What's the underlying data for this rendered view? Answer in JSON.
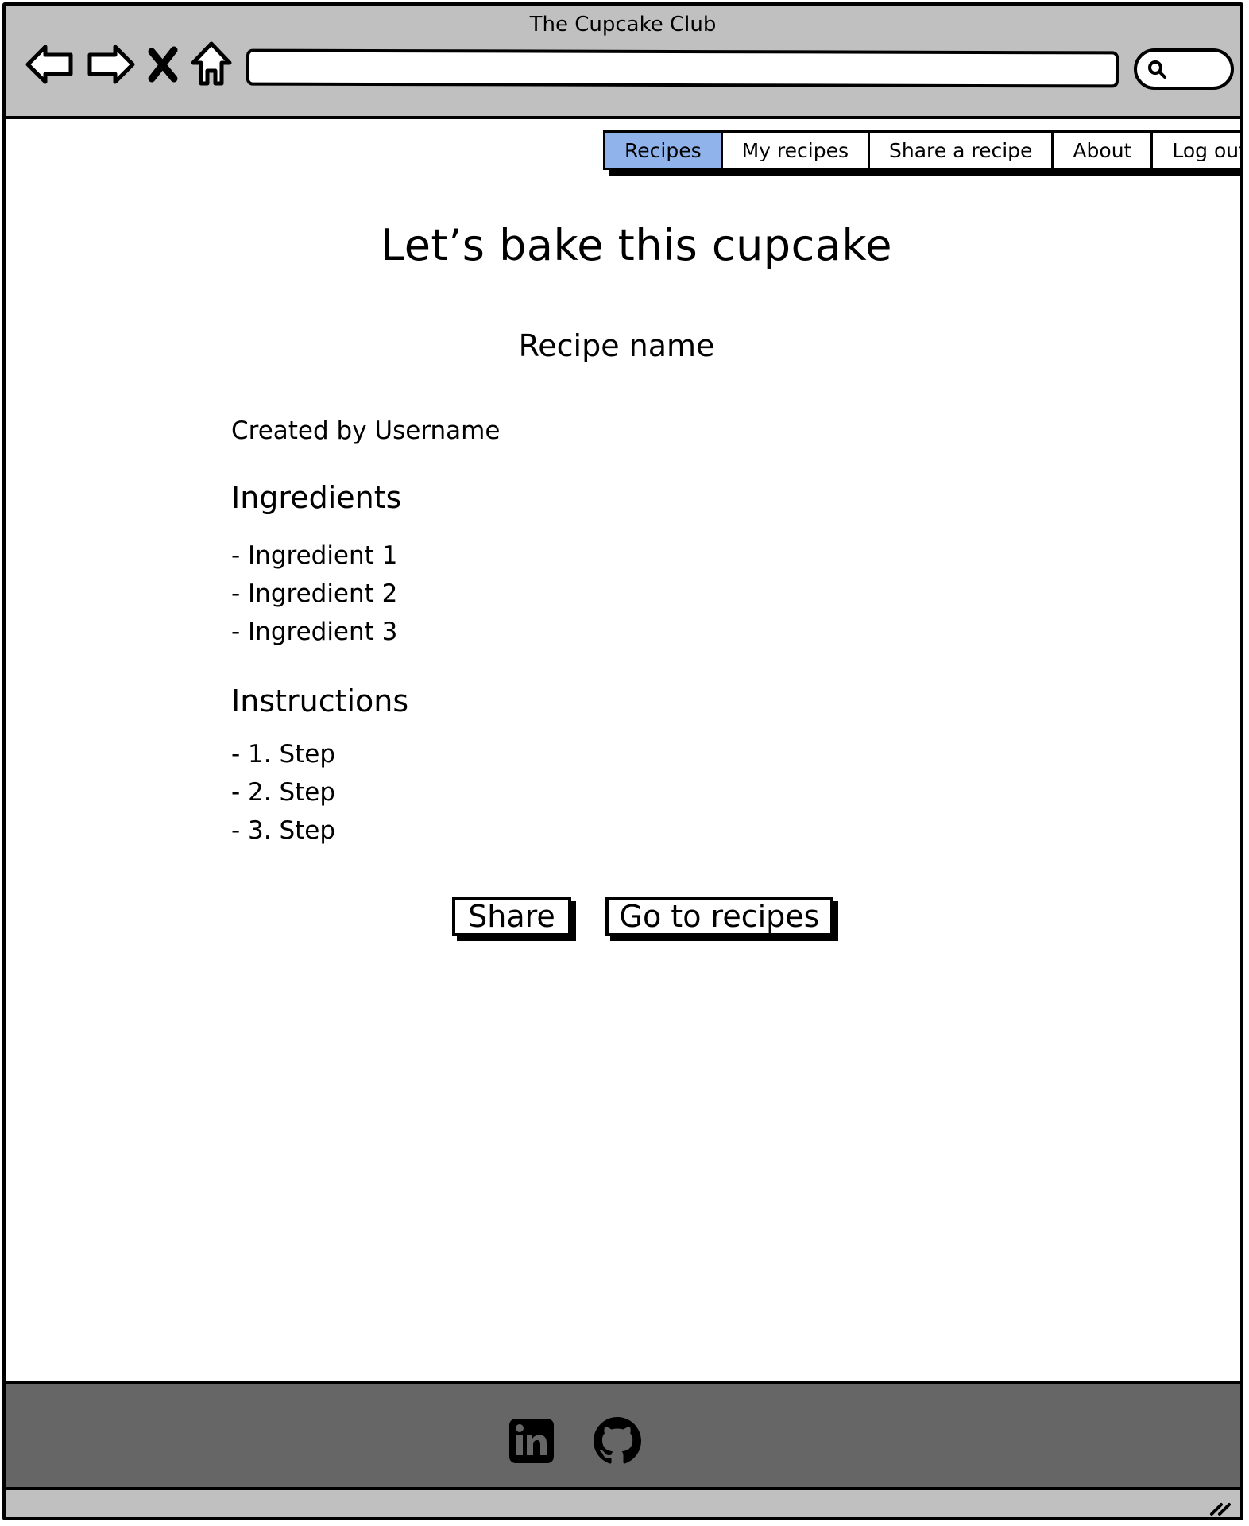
{
  "browser": {
    "window_title": "The Cupcake Club",
    "url": "",
    "search_placeholder": ""
  },
  "nav": {
    "tabs": [
      {
        "label": "Recipes",
        "active": true
      },
      {
        "label": "My recipes",
        "active": false
      },
      {
        "label": "Share a recipe",
        "active": false
      },
      {
        "label": "About",
        "active": false
      },
      {
        "label": "Log out",
        "active": false
      }
    ],
    "active_color": "#8fb3ea"
  },
  "main": {
    "title": "Let’s bake this cupcake",
    "recipe_name": "Recipe name",
    "creator": "Created by Username",
    "ingredients_heading": "Ingredients",
    "ingredients": [
      "- Ingredient 1",
      "- Ingredient 2",
      "- Ingredient 3"
    ],
    "instructions_heading": "Instructions",
    "instructions": [
      "- 1. Step",
      "- 2. Step",
      "- 3. Step"
    ],
    "share_button": "Share",
    "go_to_recipes_button": "Go to recipes"
  },
  "footer": {
    "icons": [
      "linkedin-icon",
      "github-icon"
    ],
    "background": "#666666"
  }
}
